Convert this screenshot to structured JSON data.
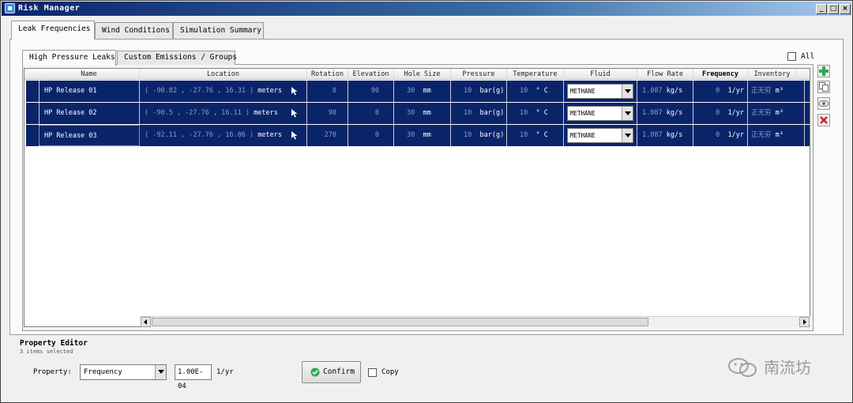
{
  "window": {
    "title": "Risk Manager",
    "minimize": "_",
    "maximize": "□",
    "close": "×"
  },
  "main_tabs": [
    {
      "label": "Leak Frequencies",
      "active": true
    },
    {
      "label": "Wind Conditions",
      "active": false
    },
    {
      "label": "Simulation Summary",
      "active": false
    }
  ],
  "sub_tabs": [
    {
      "label": "High Pressure Leaks",
      "active": true
    },
    {
      "label": "Custom Emissions / Groups",
      "active": false
    }
  ],
  "all_checkbox": {
    "label": "All",
    "checked": false
  },
  "grid": {
    "columns": [
      "Name",
      "Location",
      "Rotation",
      "Elevation",
      "Hole Size",
      "Pressure",
      "Temperature",
      "Fluid",
      "Flow Rate",
      "Frequency",
      "Inventory"
    ],
    "rows": [
      {
        "name": "HP Release 01",
        "location": "( -90.82 ,  -27.76 ,  16.31 )",
        "location_unit": "meters",
        "rotation": "0",
        "elevation": "90",
        "hole_size": "30",
        "hole_unit": "mm",
        "pressure": "10",
        "pressure_unit": "bar(g)",
        "temperature": "10",
        "temp_unit": "° C",
        "fluid": "METHANE",
        "flow_rate": "1.087",
        "flow_unit": "kg/s",
        "frequency": "0",
        "freq_unit": "1/yr",
        "inventory": "正无穷",
        "inv_unit": "m³"
      },
      {
        "name": "HP Release 02",
        "location": "( -90.5 ,  -27.76 ,  16.11 )",
        "location_unit": "meters",
        "rotation": "90",
        "elevation": "0",
        "hole_size": "30",
        "hole_unit": "mm",
        "pressure": "10",
        "pressure_unit": "bar(g)",
        "temperature": "10",
        "temp_unit": "° C",
        "fluid": "METHANE",
        "flow_rate": "1.087",
        "flow_unit": "kg/s",
        "frequency": "0",
        "freq_unit": "1/yr",
        "inventory": "正无穷",
        "inv_unit": "m³"
      },
      {
        "name": "HP Release 03",
        "location": "( -92.11 ,  -27.76 ,  16.06 )",
        "location_unit": "meters",
        "rotation": "270",
        "elevation": "0",
        "hole_size": "30",
        "hole_unit": "mm",
        "pressure": "10",
        "pressure_unit": "bar(g)",
        "temperature": "10",
        "temp_unit": "° C",
        "fluid": "METHANE",
        "flow_rate": "1.087",
        "flow_unit": "kg/s",
        "frequency": "0",
        "freq_unit": "1/yr",
        "inventory": "正无穷",
        "inv_unit": "m³"
      }
    ]
  },
  "side_toolbar": [
    {
      "icon": "plus-icon",
      "color": "#2fa84f"
    },
    {
      "icon": "copy-icon",
      "color": "#6a6a6a"
    },
    {
      "icon": "eye-icon",
      "color": "#6a6a6a"
    },
    {
      "icon": "delete-icon",
      "color": "#d42020"
    }
  ],
  "property_editor": {
    "title": "Property Editor",
    "subtitle": "3 items selected",
    "property_label": "Property:",
    "property_value": "Frequency",
    "value": "1.00E-04",
    "unit": "1/yr",
    "confirm_label": "Confirm",
    "copy_label": "Copy",
    "copy_checked": false
  },
  "watermark": {
    "text": "南流坊"
  },
  "colors": {
    "selection": "#0a246a",
    "accent_green": "#2fa84f",
    "accent_red": "#d42020"
  }
}
